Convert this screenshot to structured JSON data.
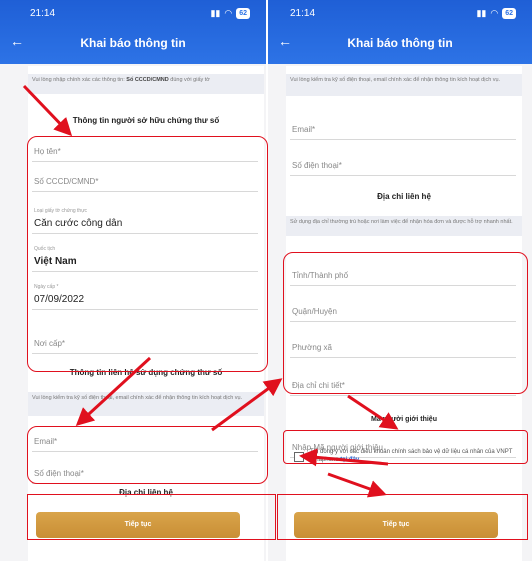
{
  "left": {
    "status_time": "21:14",
    "battery": "62",
    "header_title": "Khai báo thông tin",
    "notice_prefix": "Vui lòng nhập chính xác các thông tin: ",
    "notice_bold": "Số CCCD/CMND",
    "notice_suffix": " đúng với giấy tờ",
    "owner_section_title": "Thông tin người sở hữu chứng thư số",
    "name_placeholder": "Họ tên*",
    "id_placeholder": "Số CCCD/CMND*",
    "doc_type_label": "Loại giấy tờ chứng thực",
    "doc_type_value": "Căn cước công dân",
    "nationality_label": "Quốc tịch",
    "nationality_value": "Việt Nam",
    "issue_date_label": "Ngày cấp *",
    "issue_date_value": "07/09/2022",
    "issue_place_placeholder": "Nơi cấp*",
    "contact_section_title": "Thông tin liên hệ sử dụng chứng thư số",
    "contact_note": "Vui lòng kiểm tra kỹ số điện thoại, email chính xác để nhận thông tin kích hoạt dịch vụ.",
    "email_placeholder": "Email*",
    "phone_placeholder": "Số điện thoại*",
    "address_section_title": "Địa chỉ liên hệ",
    "continue_label": "Tiếp tục"
  },
  "right": {
    "status_time": "21:14",
    "battery": "62",
    "header_title": "Khai báo thông tin",
    "contact_note": "Vui lòng kiểm tra kỹ số điện thoại, email chính xác để nhận thông tin kích hoạt dịch vụ.",
    "email_placeholder": "Email*",
    "phone_placeholder": "Số điện thoại*",
    "address_section_title": "Địa chỉ liên hệ",
    "address_note": "Sử dụng địa chỉ thường trú hoặc nơi làm việc để nhận hóa đơn và được hỗ trợ nhanh nhất.",
    "province_placeholder": "Tỉnh/Thành phố",
    "district_placeholder": "Quận/Huyện",
    "ward_placeholder": "Phường xã",
    "address_detail_placeholder": "Địa chỉ chi tiết*",
    "referrer_section_title": "Mã người giới thiệu",
    "referrer_placeholder": "Nhập Mã người giới thiệu",
    "terms_text": "Tôi đồng ý với các điều khoản chính sách bảo vệ dữ liệu cá nhân của VNPT Vinaphone ",
    "terms_link": "tại đây",
    "continue_label": "Tiếp tục"
  },
  "colors": {
    "header_blue": "#2d73e6",
    "button_gold": "#d39a40",
    "highlight_red": "#e0101e"
  },
  "icons": [
    "back-arrow-icon",
    "signal-icon",
    "wifi-icon",
    "battery-icon",
    "arrow-annotation-icon",
    "checkbox-icon"
  ]
}
